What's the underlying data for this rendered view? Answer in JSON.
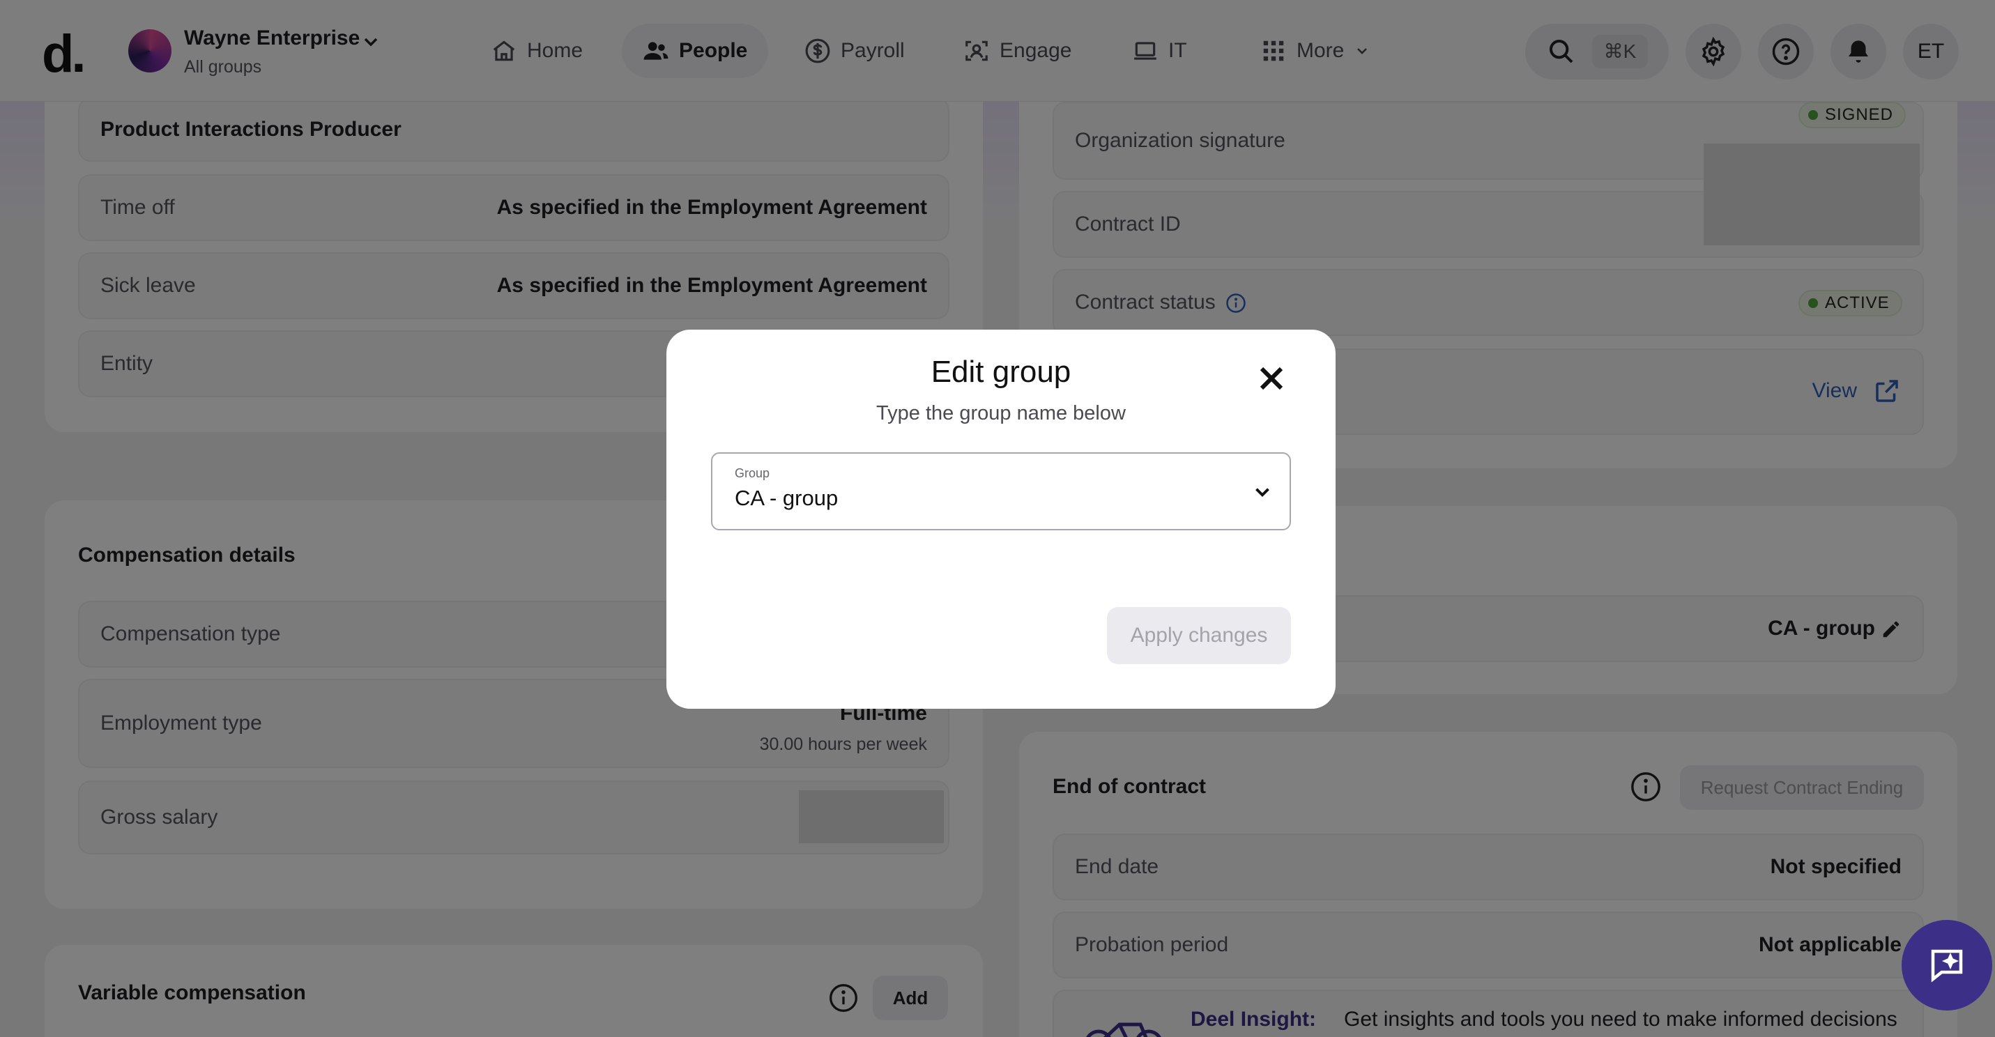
{
  "header": {
    "logo": "d.",
    "org_name": "Wayne Enterprise",
    "org_sub": "All groups",
    "nav": [
      {
        "label": "Home"
      },
      {
        "label": "People"
      },
      {
        "label": "Payroll"
      },
      {
        "label": "Engage"
      },
      {
        "label": "IT"
      },
      {
        "label": "More"
      }
    ],
    "search_shortcut": "⌘K",
    "avatar_initials": "ET"
  },
  "left_top": {
    "job_title": "Product Interactions Producer",
    "rows": [
      {
        "label": "Time off",
        "value": "As specified in the Employment Agreement"
      },
      {
        "label": "Sick leave",
        "value": "As specified in the Employment Agreement"
      },
      {
        "label": "Entity",
        "value": ""
      }
    ]
  },
  "compensation": {
    "title": "Compensation details",
    "rows": [
      {
        "label": "Compensation type",
        "value": ""
      },
      {
        "label": "Employment type",
        "value": "Full-time",
        "sub": "30.00 hours per week"
      },
      {
        "label": "Gross salary",
        "value": ""
      }
    ]
  },
  "variable": {
    "title": "Variable compensation",
    "add_label": "Add"
  },
  "contract": {
    "rows": [
      {
        "label": "Organization signature",
        "badge": "SIGNED"
      },
      {
        "label": "Contract ID",
        "value": ""
      },
      {
        "label": "Contract status",
        "badge": "ACTIVE"
      }
    ],
    "view_label": "View",
    "group_value": "CA - group"
  },
  "end_of_contract": {
    "title": "End of contract",
    "request_label": "Request Contract Ending",
    "rows": [
      {
        "label": "End date",
        "value": "Not specified"
      },
      {
        "label": "Probation period",
        "value": "Not applicable"
      }
    ],
    "insight_label": "Deel Insight:",
    "insight_text": "Get insights and tools you need to make informed decisions"
  },
  "modal": {
    "title": "Edit group",
    "subtitle": "Type the group name below",
    "field_label": "Group",
    "field_value": "CA - group",
    "apply_label": "Apply changes"
  },
  "colors": {
    "accent": "#3c2f87",
    "badge_green": "#4fa33a",
    "link_blue": "#2d5fb8"
  }
}
